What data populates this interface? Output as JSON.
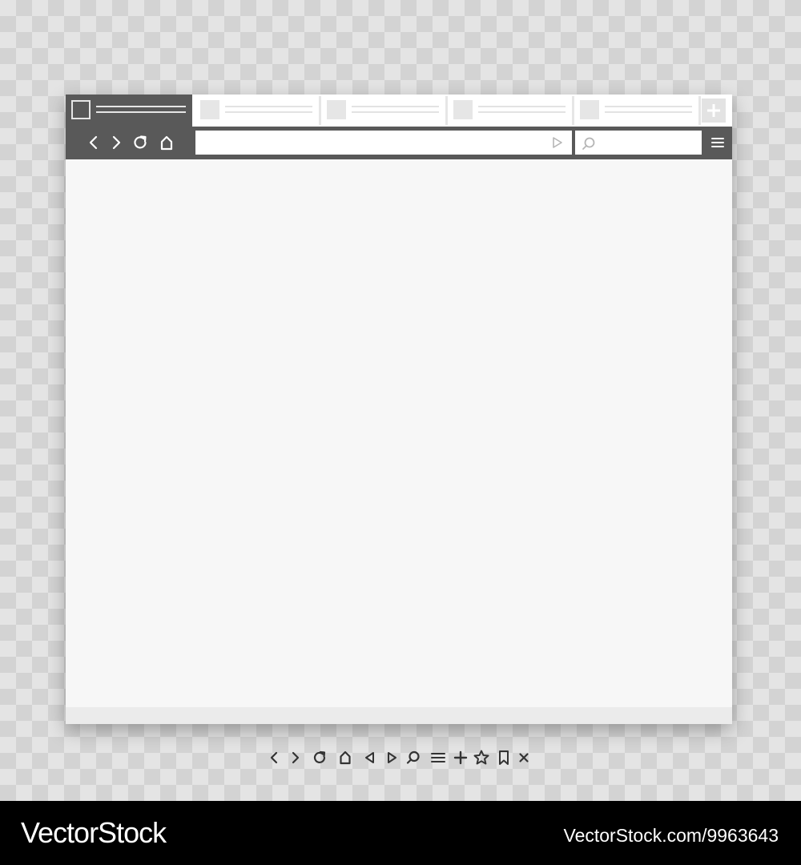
{
  "browser": {
    "tabs": [
      {
        "state": "active"
      },
      {
        "state": "inactive"
      },
      {
        "state": "inactive"
      },
      {
        "state": "inactive"
      },
      {
        "state": "inactive"
      }
    ],
    "toolbar_icons": [
      "back-icon",
      "forward-icon",
      "reload-icon",
      "home-icon"
    ],
    "address_bar": {
      "value": "",
      "go_icon": "play-icon"
    },
    "search_box": {
      "value": "",
      "icon": "search-icon"
    },
    "menu_icon": "hamburger-menu-icon",
    "new_tab_icon": "plus-icon"
  },
  "icon_set": [
    "back-icon",
    "forward-icon",
    "reload-icon",
    "home-icon",
    "triangle-left-icon",
    "triangle-right-icon",
    "search-icon",
    "menu-icon",
    "plus-icon",
    "star-icon",
    "bookmark-icon",
    "close-icon"
  ],
  "footer": {
    "brand": "VectorStock",
    "image_ref": "VectorStock.com/9963643"
  },
  "colors": {
    "chrome_dark": "#595959",
    "tab_light": "#ffffff",
    "content_bg": "#f7f7f7",
    "icon_dark": "#333333"
  }
}
